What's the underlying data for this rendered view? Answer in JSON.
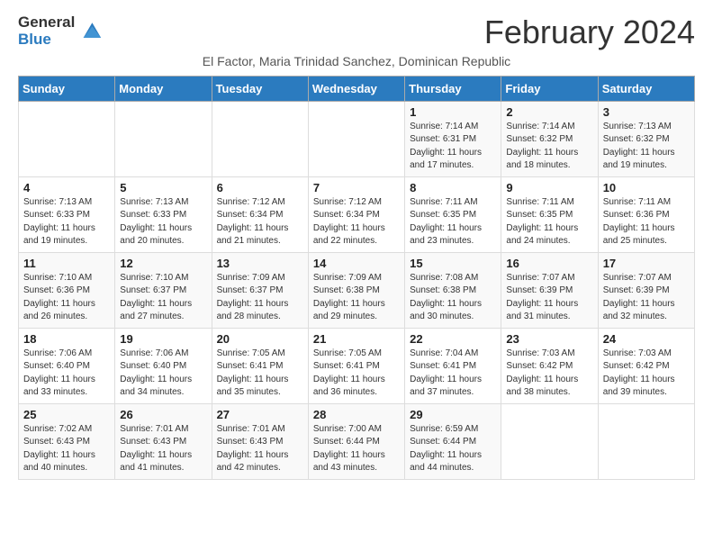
{
  "logo": {
    "line1": "General",
    "line2": "Blue"
  },
  "title": "February 2024",
  "location": "El Factor, Maria Trinidad Sanchez, Dominican Republic",
  "days_of_week": [
    "Sunday",
    "Monday",
    "Tuesday",
    "Wednesday",
    "Thursday",
    "Friday",
    "Saturday"
  ],
  "weeks": [
    [
      {
        "day": "",
        "info": ""
      },
      {
        "day": "",
        "info": ""
      },
      {
        "day": "",
        "info": ""
      },
      {
        "day": "",
        "info": ""
      },
      {
        "day": "1",
        "info": "Sunrise: 7:14 AM\nSunset: 6:31 PM\nDaylight: 11 hours and 17 minutes."
      },
      {
        "day": "2",
        "info": "Sunrise: 7:14 AM\nSunset: 6:32 PM\nDaylight: 11 hours and 18 minutes."
      },
      {
        "day": "3",
        "info": "Sunrise: 7:13 AM\nSunset: 6:32 PM\nDaylight: 11 hours and 19 minutes."
      }
    ],
    [
      {
        "day": "4",
        "info": "Sunrise: 7:13 AM\nSunset: 6:33 PM\nDaylight: 11 hours and 19 minutes."
      },
      {
        "day": "5",
        "info": "Sunrise: 7:13 AM\nSunset: 6:33 PM\nDaylight: 11 hours and 20 minutes."
      },
      {
        "day": "6",
        "info": "Sunrise: 7:12 AM\nSunset: 6:34 PM\nDaylight: 11 hours and 21 minutes."
      },
      {
        "day": "7",
        "info": "Sunrise: 7:12 AM\nSunset: 6:34 PM\nDaylight: 11 hours and 22 minutes."
      },
      {
        "day": "8",
        "info": "Sunrise: 7:11 AM\nSunset: 6:35 PM\nDaylight: 11 hours and 23 minutes."
      },
      {
        "day": "9",
        "info": "Sunrise: 7:11 AM\nSunset: 6:35 PM\nDaylight: 11 hours and 24 minutes."
      },
      {
        "day": "10",
        "info": "Sunrise: 7:11 AM\nSunset: 6:36 PM\nDaylight: 11 hours and 25 minutes."
      }
    ],
    [
      {
        "day": "11",
        "info": "Sunrise: 7:10 AM\nSunset: 6:36 PM\nDaylight: 11 hours and 26 minutes."
      },
      {
        "day": "12",
        "info": "Sunrise: 7:10 AM\nSunset: 6:37 PM\nDaylight: 11 hours and 27 minutes."
      },
      {
        "day": "13",
        "info": "Sunrise: 7:09 AM\nSunset: 6:37 PM\nDaylight: 11 hours and 28 minutes."
      },
      {
        "day": "14",
        "info": "Sunrise: 7:09 AM\nSunset: 6:38 PM\nDaylight: 11 hours and 29 minutes."
      },
      {
        "day": "15",
        "info": "Sunrise: 7:08 AM\nSunset: 6:38 PM\nDaylight: 11 hours and 30 minutes."
      },
      {
        "day": "16",
        "info": "Sunrise: 7:07 AM\nSunset: 6:39 PM\nDaylight: 11 hours and 31 minutes."
      },
      {
        "day": "17",
        "info": "Sunrise: 7:07 AM\nSunset: 6:39 PM\nDaylight: 11 hours and 32 minutes."
      }
    ],
    [
      {
        "day": "18",
        "info": "Sunrise: 7:06 AM\nSunset: 6:40 PM\nDaylight: 11 hours and 33 minutes."
      },
      {
        "day": "19",
        "info": "Sunrise: 7:06 AM\nSunset: 6:40 PM\nDaylight: 11 hours and 34 minutes."
      },
      {
        "day": "20",
        "info": "Sunrise: 7:05 AM\nSunset: 6:41 PM\nDaylight: 11 hours and 35 minutes."
      },
      {
        "day": "21",
        "info": "Sunrise: 7:05 AM\nSunset: 6:41 PM\nDaylight: 11 hours and 36 minutes."
      },
      {
        "day": "22",
        "info": "Sunrise: 7:04 AM\nSunset: 6:41 PM\nDaylight: 11 hours and 37 minutes."
      },
      {
        "day": "23",
        "info": "Sunrise: 7:03 AM\nSunset: 6:42 PM\nDaylight: 11 hours and 38 minutes."
      },
      {
        "day": "24",
        "info": "Sunrise: 7:03 AM\nSunset: 6:42 PM\nDaylight: 11 hours and 39 minutes."
      }
    ],
    [
      {
        "day": "25",
        "info": "Sunrise: 7:02 AM\nSunset: 6:43 PM\nDaylight: 11 hours and 40 minutes."
      },
      {
        "day": "26",
        "info": "Sunrise: 7:01 AM\nSunset: 6:43 PM\nDaylight: 11 hours and 41 minutes."
      },
      {
        "day": "27",
        "info": "Sunrise: 7:01 AM\nSunset: 6:43 PM\nDaylight: 11 hours and 42 minutes."
      },
      {
        "day": "28",
        "info": "Sunrise: 7:00 AM\nSunset: 6:44 PM\nDaylight: 11 hours and 43 minutes."
      },
      {
        "day": "29",
        "info": "Sunrise: 6:59 AM\nSunset: 6:44 PM\nDaylight: 11 hours and 44 minutes."
      },
      {
        "day": "",
        "info": ""
      },
      {
        "day": "",
        "info": ""
      }
    ]
  ]
}
